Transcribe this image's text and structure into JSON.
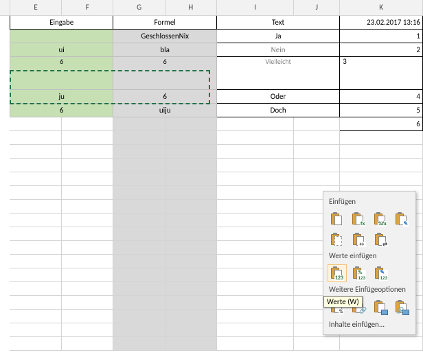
{
  "columns": {
    "E": "E",
    "F": "F",
    "G": "G",
    "H": "H",
    "I": "I",
    "J": "J",
    "K": "K"
  },
  "headers": {
    "eingabe": "Eingabe",
    "formel": "Formel",
    "text": "Text",
    "timestamp": "23.02.2017 13:16"
  },
  "rows": {
    "r3": {
      "formel_top": "GeschlossenNix",
      "I": "Ja",
      "K": "1"
    },
    "r4": {
      "eingabe": "ui",
      "formel": "bla",
      "I": "Nein",
      "K": "2"
    },
    "r5": {
      "eingabe": "6",
      "formel": "6",
      "I": "Vielleicht",
      "K": "3"
    },
    "r6": {
      "eingabe": "ju",
      "formel": "6",
      "I": "Oder",
      "K": "4"
    },
    "r7": {
      "eingabe": "6",
      "formel": "uiju",
      "I": "Doch",
      "K": "5"
    },
    "r8": {
      "K": "6"
    }
  },
  "popup": {
    "section1": "Einfügen",
    "section2": "Werte einfügen",
    "section3": "Weitere Einfügeoptionen",
    "link": "Inhalte einfügen...",
    "tooltip": "Werte (W)",
    "icons": {
      "fx": "fx",
      "pctfx": "%fx",
      "v123": "123",
      "pct": "%"
    }
  },
  "chart_data": null
}
